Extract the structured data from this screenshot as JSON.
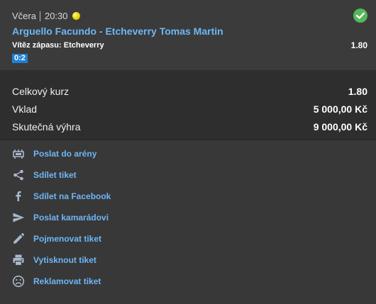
{
  "bet": {
    "day": "Včera",
    "time": "20:30",
    "sport_icon": "tennis-ball-icon",
    "status_icon": "check-circle-icon",
    "status_color": "#55b85a",
    "match": "Arguello Facundo - Etcheverry Tomas Martin",
    "pick": "Vítěz zápasu: Etcheverry",
    "odds": "1.80",
    "score": "0:2"
  },
  "summary": [
    {
      "label": "Celkový kurz",
      "value": "1.80"
    },
    {
      "label": "Vklad",
      "value": "5 000,00 Kč"
    },
    {
      "label": "Skutečná výhra",
      "value": "9 000,00 Kč"
    }
  ],
  "actions": [
    {
      "label": "Poslat do arény",
      "icon": "arena-icon"
    },
    {
      "label": "Sdílet tiket",
      "icon": "share-icon"
    },
    {
      "label": "Sdílet na Facebook",
      "icon": "facebook-icon"
    },
    {
      "label": "Poslat kamarádovi",
      "icon": "send-icon"
    },
    {
      "label": "Pojmenovat tiket",
      "icon": "pencil-icon"
    },
    {
      "label": "Vytisknout tiket",
      "icon": "printer-icon"
    },
    {
      "label": "Reklamovat tiket",
      "icon": "sad-face-icon"
    }
  ],
  "colors": {
    "accent_link": "#6eb6f6",
    "score_badge": "#1f7fd4",
    "icon_gray": "#a9b8cc"
  }
}
